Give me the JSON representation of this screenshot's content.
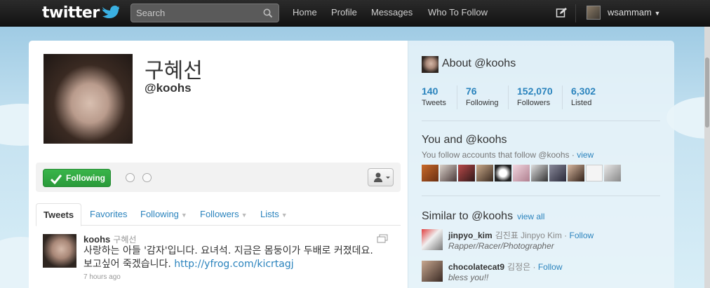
{
  "topbar": {
    "logo": "twitter",
    "search_placeholder": "Search",
    "nav": [
      "Home",
      "Profile",
      "Messages",
      "Who To Follow"
    ],
    "username": "wsammam",
    "colors": {
      "bar": "#1a1a1a",
      "link": "#2a83bd",
      "follow_green": "#39b54a"
    }
  },
  "profile": {
    "display_name": "구혜선",
    "handle": "@koohs",
    "follow_button": "Following"
  },
  "tabs": [
    "Tweets",
    "Favorites",
    "Following",
    "Followers",
    "Lists"
  ],
  "tweet": {
    "user": "koohs",
    "fullname": "구혜선",
    "text": "사랑하는 아들 '감자'입니다. 요녀석. 지금은 몸둥이가 두배로 커졌데요. 보고싶어 죽겠습니다. ",
    "link": "http://yfrog.com/kicrtagj",
    "time": "7 hours ago"
  },
  "about": {
    "title": "About @koohs",
    "stats": [
      {
        "value": "140",
        "label": "Tweets"
      },
      {
        "value": "76",
        "label": "Following"
      },
      {
        "value": "152,070",
        "label": "Followers"
      },
      {
        "value": "6,302",
        "label": "Listed"
      }
    ]
  },
  "you_and": {
    "title": "You and @koohs",
    "subtitle": "You follow accounts that follow @koohs · ",
    "view": "view"
  },
  "similar": {
    "title": "Similar to @koohs",
    "view_all": "view all",
    "items": [
      {
        "username": "jinpyo_kim",
        "fullname": "김진표 Jinpyo Kim · ",
        "follow": "Follow",
        "bio": "Rapper/Racer/Photographer"
      },
      {
        "username": "chocolatecat9",
        "fullname": "김정은 · ",
        "follow": "Follow",
        "bio": "bless you!!"
      }
    ]
  }
}
